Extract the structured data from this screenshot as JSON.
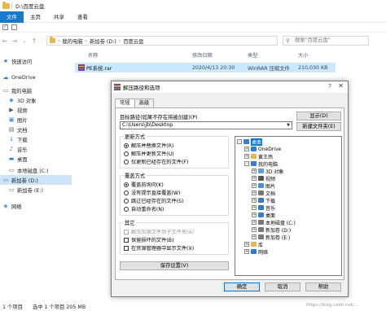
{
  "explorer": {
    "title_path": "D:\\百度云盘",
    "tabs": [
      "文件",
      "主页",
      "共享",
      "查看"
    ],
    "breadcrumb": [
      "我的电脑",
      "新加卷 (D:)",
      "百度云盘"
    ],
    "search_placeholder": "搜索\"百度云盘\"",
    "sidebar": [
      {
        "label": "快速访问",
        "icon": "star-icon",
        "color": "#2b7cd3"
      },
      {
        "label": "OneDrive",
        "icon": "cloud-icon",
        "color": "#2b7cd3"
      },
      {
        "label": "我的电脑",
        "icon": "computer-icon",
        "color": "#3a7bd5"
      },
      {
        "label": "3D 对象",
        "icon": "cube-icon",
        "color": "#5aa0e0"
      },
      {
        "label": "视频",
        "icon": "video-icon",
        "color": "#555"
      },
      {
        "label": "图片",
        "icon": "picture-icon",
        "color": "#4a90d9"
      },
      {
        "label": "文档",
        "icon": "document-icon",
        "color": "#666"
      },
      {
        "label": "下载",
        "icon": "download-icon",
        "color": "#2b7cd3"
      },
      {
        "label": "音乐",
        "icon": "music-icon",
        "color": "#2b7cd3"
      },
      {
        "label": "桌面",
        "icon": "desktop-icon",
        "color": "#3a7bd5"
      },
      {
        "label": "本地磁盘 (C:)",
        "icon": "drive-icon",
        "color": "#666"
      },
      {
        "label": "新加卷 (D:)",
        "icon": "drive-icon",
        "color": "#666",
        "selected": true
      },
      {
        "label": "新加卷 (E:)",
        "icon": "drive-icon",
        "color": "#666"
      },
      {
        "label": "网络",
        "icon": "network-icon",
        "color": "#2b7cd3"
      }
    ],
    "columns": [
      "名称",
      "修改日期",
      "类型",
      "大小"
    ],
    "files": [
      {
        "name": "PE系统.rar",
        "date": "2020/4/13 20:30",
        "type": "WinRAR 压缩文件",
        "size": "210,030 KB"
      }
    ],
    "status": {
      "count": "1 个项目",
      "selected": "选中 1 个项目 205 MB"
    }
  },
  "dialog": {
    "title": "解压路径和选项",
    "help": "?",
    "tabs": [
      "常规",
      "高级"
    ],
    "target_label": "目标路径(如果不存在将被创建)(P)",
    "target_value": "C:\\Users\\jb\\Desktop",
    "show_button": "显示(D)",
    "new_folder_button": "新建文件夹(E)",
    "update_group": {
      "title": "更新方式",
      "options": [
        {
          "label": "解压并替换文件(R)",
          "checked": true
        },
        {
          "label": "解压并更新文件(U)",
          "checked": false
        },
        {
          "label": "仅更新已经存在的文件(F)",
          "checked": false
        }
      ]
    },
    "overwrite_group": {
      "title": "覆盖方式",
      "options": [
        {
          "label": "覆盖前询问(K)",
          "checked": true
        },
        {
          "label": "没有提示直接覆盖(W)",
          "checked": false
        },
        {
          "label": "跳过已经存在的文件(S)",
          "checked": false
        },
        {
          "label": "自动重命名(N)",
          "checked": false
        }
      ]
    },
    "misc_group": {
      "title": "其它",
      "options": [
        {
          "label": "解压压缩文件到子文件夹(A)",
          "checked": false,
          "disabled": true
        },
        {
          "label": "保留损坏的文件(B)",
          "checked": false,
          "disabled": false
        },
        {
          "label": "在资源管理器中显示文件(X)",
          "checked": false,
          "disabled": false
        }
      ]
    },
    "save_button": "保存设置(V)",
    "tree": [
      {
        "label": "桌面",
        "depth": 0,
        "exp": "-",
        "icon": "desktop-icon",
        "selected": true,
        "color": "#3a7bd5"
      },
      {
        "label": "OneDrive",
        "depth": 1,
        "exp": "+",
        "icon": "cloud-icon",
        "color": "#2b7cd3"
      },
      {
        "label": "黄王炜",
        "depth": 1,
        "exp": "+",
        "icon": "user-icon",
        "color": "#e6b653"
      },
      {
        "label": "我的电脑",
        "depth": 1,
        "exp": "-",
        "icon": "computer-icon",
        "color": "#3a7bd5"
      },
      {
        "label": "3D 对象",
        "depth": 2,
        "exp": "+",
        "icon": "cube-icon",
        "color": "#5aa0e0"
      },
      {
        "label": "视频",
        "depth": 2,
        "exp": "+",
        "icon": "video-icon",
        "color": "#555"
      },
      {
        "label": "图片",
        "depth": 2,
        "exp": "+",
        "icon": "picture-icon",
        "color": "#4a90d9"
      },
      {
        "label": "文档",
        "depth": 2,
        "exp": "+",
        "icon": "document-icon",
        "color": "#777"
      },
      {
        "label": "下载",
        "depth": 2,
        "exp": "+",
        "icon": "download-icon",
        "color": "#2b7cd3"
      },
      {
        "label": "音乐",
        "depth": 2,
        "exp": "+",
        "icon": "music-icon",
        "color": "#2b7cd3"
      },
      {
        "label": "桌面",
        "depth": 2,
        "exp": "+",
        "icon": "desktop-icon",
        "color": "#3a7bd5"
      },
      {
        "label": "本地磁盘 (C:)",
        "depth": 2,
        "exp": "+",
        "icon": "drive-icon",
        "color": "#777"
      },
      {
        "label": "新加卷 (D:)",
        "depth": 2,
        "exp": "+",
        "icon": "drive-icon",
        "color": "#777"
      },
      {
        "label": "新加卷 (E:)",
        "depth": 2,
        "exp": "+",
        "icon": "drive-icon",
        "color": "#777"
      },
      {
        "label": "库",
        "depth": 1,
        "exp": "+",
        "icon": "library-icon",
        "color": "#e6b653"
      },
      {
        "label": "网络",
        "depth": 1,
        "exp": "+",
        "icon": "network-icon",
        "color": "#2b7cd3"
      }
    ],
    "ok_button": "确定",
    "cancel_button": "取消",
    "help_button": "帮助"
  },
  "watermark": "https://blog.csdn.net/..."
}
